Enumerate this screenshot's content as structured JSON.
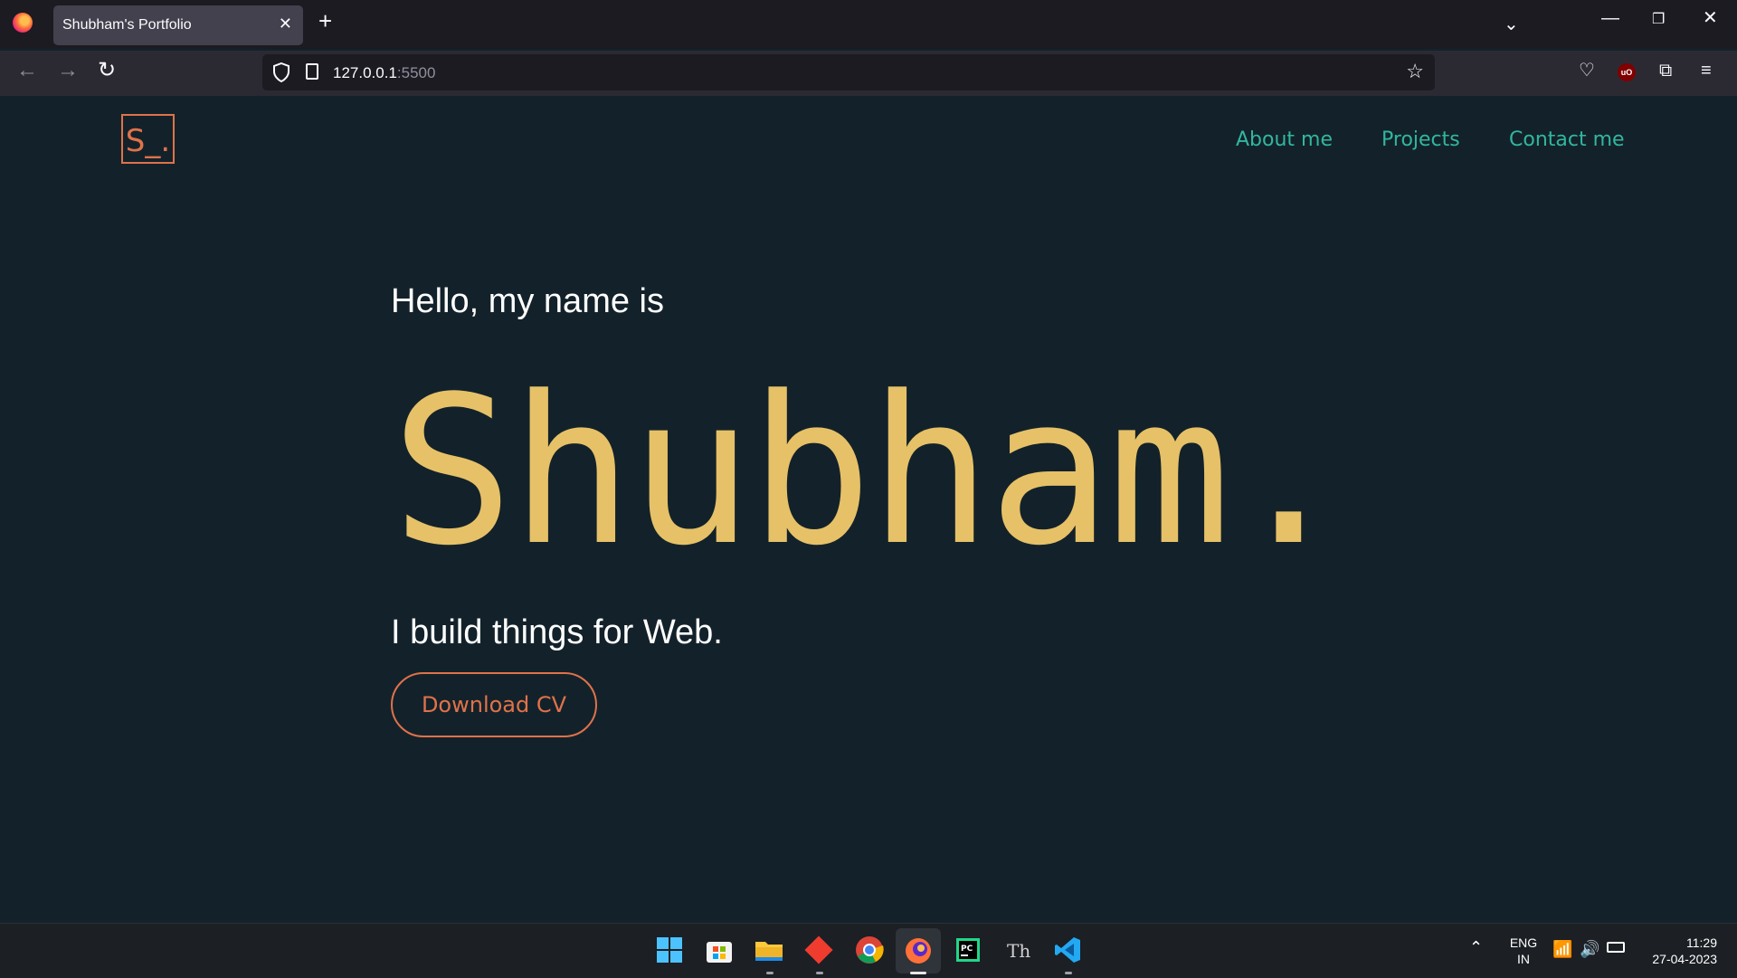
{
  "browser": {
    "tab_title": "Shubham's Portfolio",
    "url_host": "127.0.0.1",
    "url_port": ":5500",
    "new_tab_label": "+",
    "close_tab_label": "✕"
  },
  "site": {
    "logo_text": "S_.",
    "nav": [
      {
        "label": "About me"
      },
      {
        "label": "Projects"
      },
      {
        "label": "Contact me"
      }
    ],
    "hero": {
      "greeting": "Hello, my name is",
      "name": "Shubham.",
      "tagline": "I build things for Web.",
      "cta_label": "Download CV"
    },
    "colors": {
      "background": "#13222a",
      "accent_orange": "#e0724a",
      "accent_yellow": "#e6c168",
      "accent_teal": "#32b6a0"
    }
  },
  "taskbar": {
    "apps": [
      {
        "name": "windows-start-icon"
      },
      {
        "name": "microsoft-store-icon"
      },
      {
        "name": "file-explorer-icon"
      },
      {
        "name": "git-icon"
      },
      {
        "name": "chrome-icon"
      },
      {
        "name": "firefox-icon"
      },
      {
        "name": "pycharm-icon"
      },
      {
        "name": "typora-icon"
      },
      {
        "name": "vscode-icon"
      }
    ],
    "lang_line1": "ENG",
    "lang_line2": "IN",
    "time": "11:29",
    "date": "27-04-2023"
  }
}
